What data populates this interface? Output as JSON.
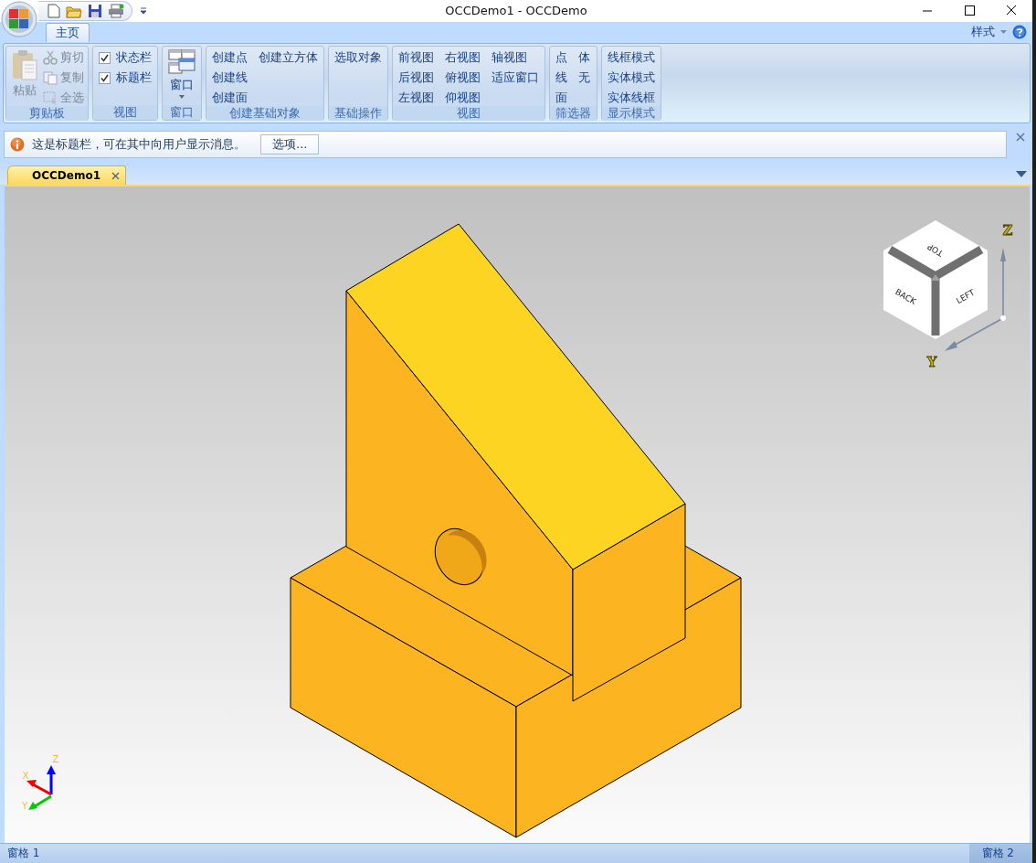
{
  "window": {
    "title": "OCCDemo1 - OCCDemo"
  },
  "ribbon": {
    "tabs": [
      {
        "label": "主页",
        "selected": true
      }
    ],
    "style_menu": "样式",
    "groups": [
      {
        "label": "剪贴板",
        "items": [
          {
            "kind": "large",
            "label": "粘贴",
            "disabled": true
          },
          {
            "kind": "small",
            "label": "剪切",
            "disabled": true
          },
          {
            "kind": "small",
            "label": "复制",
            "disabled": true
          },
          {
            "kind": "small",
            "label": "全选",
            "disabled": true
          }
        ]
      },
      {
        "label": "视图",
        "items": [
          {
            "kind": "checkbox",
            "label": "状态栏",
            "checked": true
          },
          {
            "kind": "checkbox",
            "label": "标题栏",
            "checked": true
          }
        ]
      },
      {
        "label": "窗口",
        "items": [
          {
            "kind": "dropdown",
            "label": "窗口"
          }
        ]
      },
      {
        "label": "创建基础对象",
        "items": [
          {
            "kind": "text",
            "label": "创建点"
          },
          {
            "kind": "text",
            "label": "创建线"
          },
          {
            "kind": "text",
            "label": "创建面"
          },
          {
            "kind": "text",
            "label": "创建立方体"
          }
        ]
      },
      {
        "label": "基础操作",
        "items": [
          {
            "kind": "text",
            "label": "选取对象"
          }
        ]
      },
      {
        "label": "视图",
        "items": [
          {
            "kind": "text",
            "label": "前视图"
          },
          {
            "kind": "text",
            "label": "后视图"
          },
          {
            "kind": "text",
            "label": "左视图"
          },
          {
            "kind": "text",
            "label": "右视图"
          },
          {
            "kind": "text",
            "label": "俯视图"
          },
          {
            "kind": "text",
            "label": "仰视图"
          },
          {
            "kind": "text",
            "label": "轴视图"
          },
          {
            "kind": "text",
            "label": "适应窗口"
          }
        ]
      },
      {
        "label": "筛选器",
        "items": [
          {
            "kind": "text",
            "label": "点"
          },
          {
            "kind": "text",
            "label": "线"
          },
          {
            "kind": "text",
            "label": "面"
          },
          {
            "kind": "text",
            "label": "体"
          },
          {
            "kind": "text",
            "label": "无"
          }
        ]
      },
      {
        "label": "显示模式",
        "items": [
          {
            "kind": "text",
            "label": "线框模式"
          },
          {
            "kind": "text",
            "label": "实体模式"
          },
          {
            "kind": "text",
            "label": "实体线框"
          }
        ]
      }
    ]
  },
  "message_bar": {
    "text": "这是标题栏，可在其中向用户显示消息。",
    "button": "选项..."
  },
  "document_tabs": [
    {
      "label": "OCCDemo1",
      "selected": true
    }
  ],
  "viewport": {
    "view_cube": {
      "faces": [
        "TOP",
        "BACK",
        "LEFT"
      ],
      "axes": [
        "Z",
        "Y"
      ]
    },
    "triad": [
      "Z",
      "X",
      "Y"
    ]
  },
  "status_bar": {
    "panes": [
      "窗格 1",
      "窗格 2"
    ]
  }
}
